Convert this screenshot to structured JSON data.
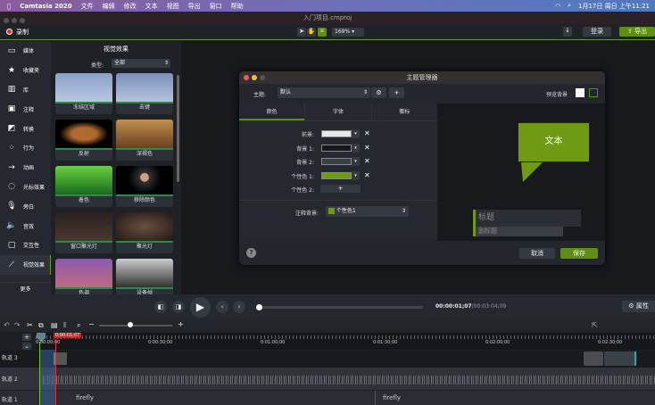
{
  "menubar": {
    "app": "Camtasia 2020",
    "items": [
      "文件",
      "编辑",
      "修改",
      "文本",
      "视图",
      "导出",
      "窗口",
      "帮助"
    ],
    "clock": "1月17日 周日 上午11:21"
  },
  "window": {
    "title": "入门项目.cmproj"
  },
  "toolbar": {
    "record": "录制",
    "zoom": "169%",
    "login": "登录",
    "export": "导出"
  },
  "sidebar": {
    "items": [
      {
        "label": "媒体",
        "icon": "film-icon"
      },
      {
        "label": "收藏夹",
        "icon": "star-icon"
      },
      {
        "label": "库",
        "icon": "library-icon"
      },
      {
        "label": "注释",
        "icon": "annotation-icon"
      },
      {
        "label": "转换",
        "icon": "transition-icon"
      },
      {
        "label": "行为",
        "icon": "behavior-icon"
      },
      {
        "label": "动画",
        "icon": "animation-icon"
      },
      {
        "label": "光标效果",
        "icon": "cursor-icon"
      },
      {
        "label": "旁白",
        "icon": "microphone-icon"
      },
      {
        "label": "音效",
        "icon": "speaker-icon"
      },
      {
        "label": "交互性",
        "icon": "interactive-icon"
      },
      {
        "label": "视觉效果",
        "icon": "wand-icon"
      }
    ],
    "more": "更多"
  },
  "effects": {
    "title": "视觉效果",
    "type_label": "类型:",
    "type_value": "全部",
    "items": [
      "冻结区域",
      "击键",
      "反射",
      "深褐色",
      "着色",
      "移除颜色",
      "窗口聚光灯",
      "聚光灯",
      "色调",
      "设备帧"
    ]
  },
  "dialog": {
    "title": "主题管理器",
    "theme_label": "主题:",
    "theme_value": "默认",
    "preview_bg": "预览背景",
    "tabs": [
      "颜色",
      "字体",
      "徽标"
    ],
    "colors": [
      {
        "label": "前景:",
        "color": "#e8e8ea"
      },
      {
        "label": "背景 1:",
        "color": "#15181d"
      },
      {
        "label": "背景 2:",
        "color": "#3a3f47"
      },
      {
        "label": "个性色 1:",
        "color": "#6e9a14"
      }
    ],
    "accent2_label": "个性色 2:",
    "annotation_bg_label": "注释背景:",
    "annotation_bg_value": "个性色1",
    "preview": {
      "callout": "文本",
      "title": "标题",
      "subtitle": "副标题"
    },
    "cancel": "取消",
    "save": "保存"
  },
  "playback": {
    "time_current": "00:00:01;07",
    "time_total": "00:03:04;09",
    "properties": "属性"
  },
  "timeline": {
    "playhead": "0:00:01;07",
    "ticks": [
      "0:00:00;00",
      "0:00:30;00",
      "0:01:00;00",
      "0:01:30;00",
      "0:02:00;00",
      "0:02:30;00"
    ],
    "tracks": [
      "轨道 3",
      "轨道 2",
      "轨道 1"
    ],
    "clip_labels": [
      "firefly",
      "firefly"
    ]
  },
  "accent": "#6a9a1a"
}
